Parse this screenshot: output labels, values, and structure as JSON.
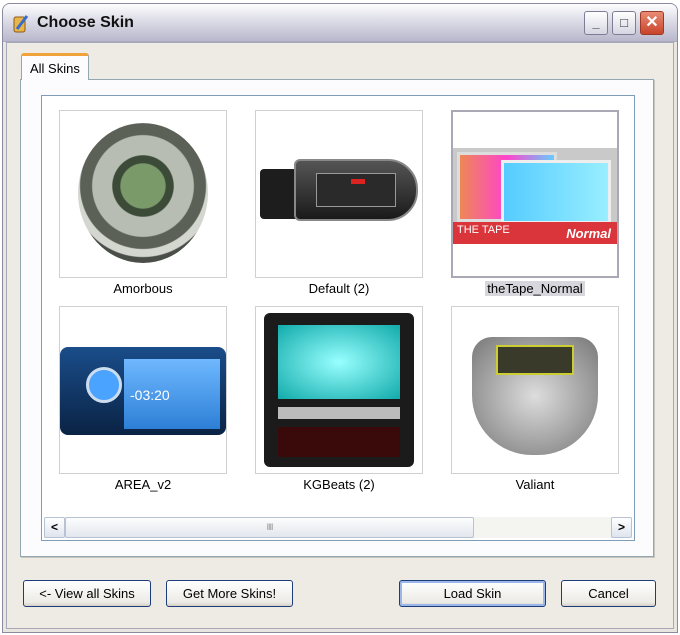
{
  "window": {
    "title": "Choose Skin",
    "minimize_icon": "minimize-icon",
    "maximize_icon": "maximize-icon",
    "close_icon": "close-icon"
  },
  "tabs": [
    {
      "label": "All Skins",
      "active": true
    }
  ],
  "skins": [
    {
      "label": "Amorbous",
      "selected": false
    },
    {
      "label": "Default (2)",
      "selected": false
    },
    {
      "label": "theTape_Normal",
      "selected": true,
      "thumb_text": "THE TAPE",
      "thumb_sub": "Normal"
    },
    {
      "label": "AREA_v2",
      "selected": false,
      "thumb_text": "-03:20"
    },
    {
      "label": "KGBeats (2)",
      "selected": false
    },
    {
      "label": "Valiant",
      "selected": false
    }
  ],
  "scrollbar": {
    "left_icon": "<",
    "right_icon": ">",
    "grip": "IIII"
  },
  "buttons": {
    "view_all": "<- View all Skins",
    "get_more": "Get More Skins!",
    "load": "Load Skin",
    "cancel": "Cancel"
  }
}
